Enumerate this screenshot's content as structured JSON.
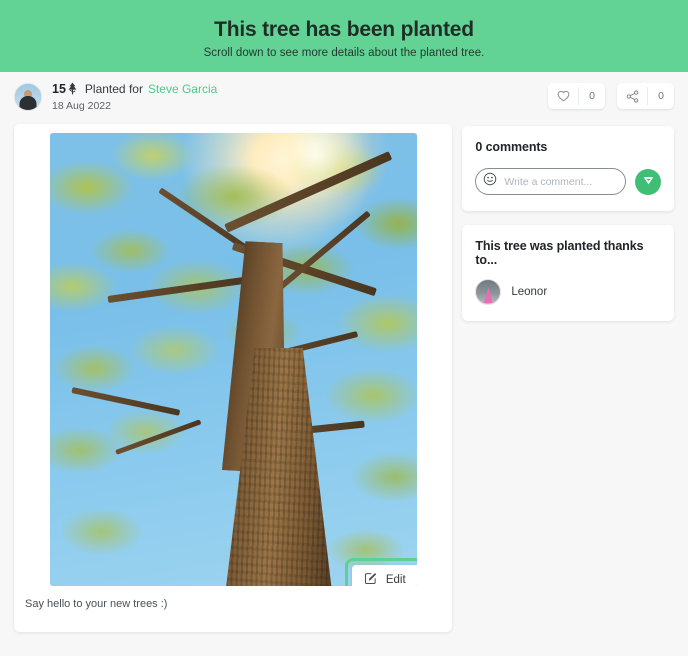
{
  "banner": {
    "title": "This tree has been planted",
    "subtitle": "Scroll down to see more details about the planted tree.",
    "bg_color": "#62d395"
  },
  "post": {
    "tree_count": "15",
    "tree_icon": "tree-icon",
    "planted_for_label": "Planted for",
    "recipient": "Steve Garcia",
    "recipient_color": "#4ec98a",
    "date": "18 Aug 2022",
    "avatar": "user-avatar",
    "caption": "Say hello to your new trees :)",
    "photo_alt": "tree-canopy-photo",
    "edit_button": {
      "label": "Edit",
      "icon": "edit-pencil-icon",
      "focus_ring_color": "#5fd091"
    }
  },
  "actions": {
    "like": {
      "icon": "heart-icon",
      "count": "0"
    },
    "share": {
      "icon": "share-icon",
      "count": "0"
    }
  },
  "comments": {
    "title": "0 comments",
    "emoji_icon": "smiley-icon",
    "placeholder": "Write a comment...",
    "input_value": "",
    "send_icon": "send-icon",
    "send_color": "#3fbf76"
  },
  "thanks": {
    "title": "This tree was planted thanks to...",
    "people": [
      {
        "name": "Leonor",
        "avatar": "leonor-avatar"
      }
    ]
  }
}
